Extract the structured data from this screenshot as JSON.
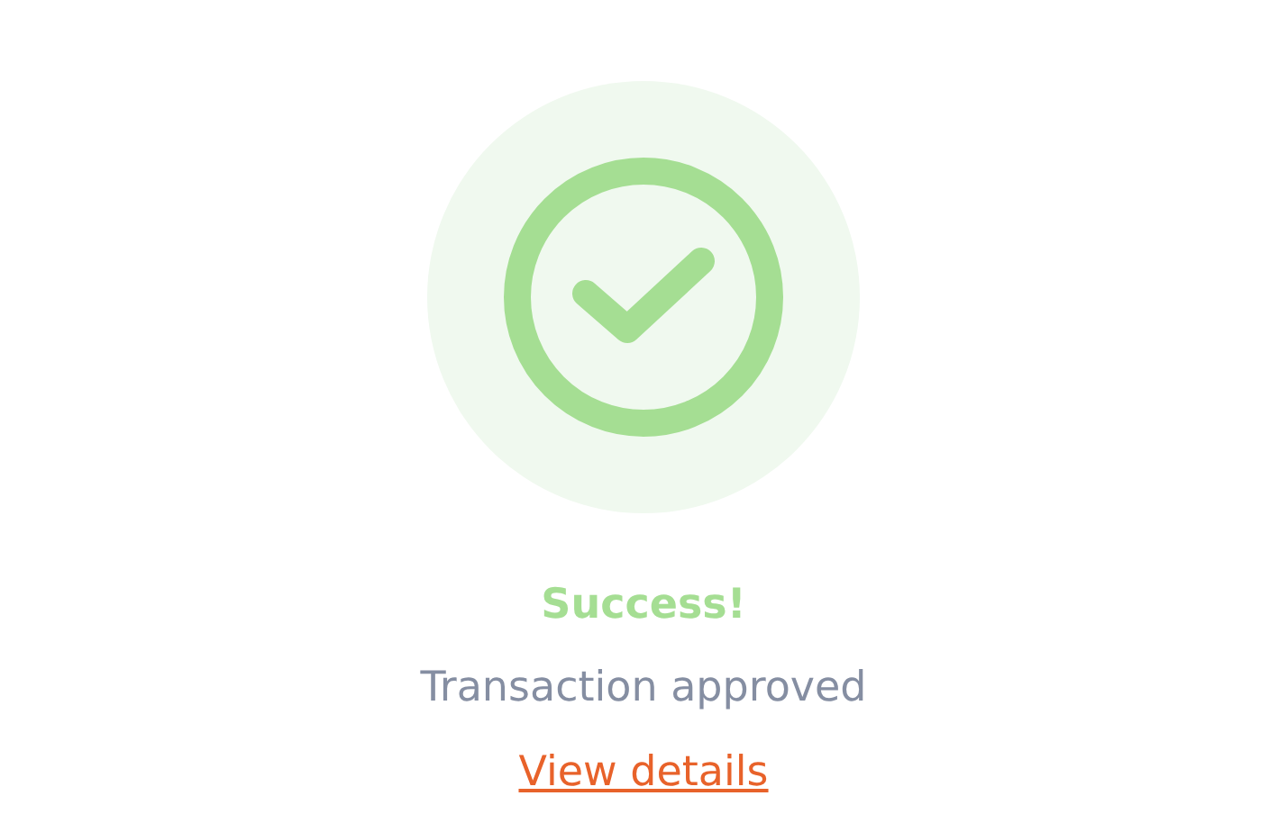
{
  "status": {
    "title": "Success!",
    "message": "Transaction approved"
  },
  "link": {
    "label": "View details"
  }
}
